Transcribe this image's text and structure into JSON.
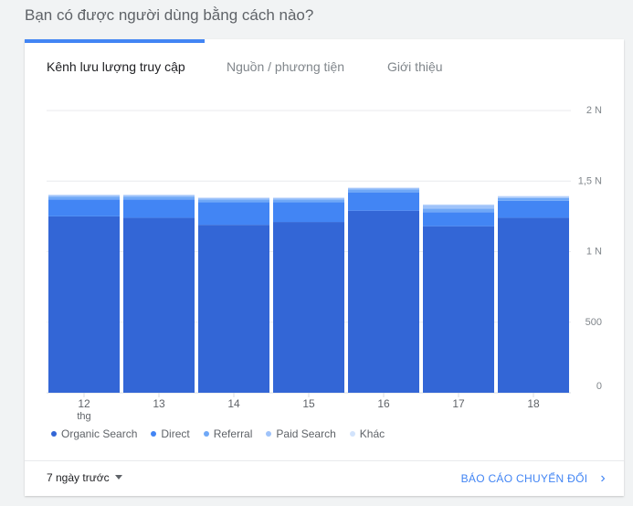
{
  "question": "Bạn có được người dùng bằng cách nào?",
  "tabs": [
    {
      "label": "Kênh lưu lượng truy cập",
      "active": true
    },
    {
      "label": "Nguồn / phương tiện",
      "active": false
    },
    {
      "label": "Giới thiệu",
      "active": false
    }
  ],
  "footer": {
    "range_label": "7 ngày trước",
    "report_label": "BÁO CÁO CHUYỂN ĐỔI"
  },
  "chart_data": {
    "type": "bar",
    "stacked": true,
    "categories": [
      "12",
      "13",
      "14",
      "15",
      "16",
      "17",
      "18"
    ],
    "category_sublabels": [
      "thg",
      "",
      "",
      "",
      "",
      "",
      ""
    ],
    "series": [
      {
        "name": "Organic Search",
        "color": "#3366d6",
        "values": [
          1250,
          1240,
          1190,
          1210,
          1290,
          1180,
          1240
        ]
      },
      {
        "name": "Direct",
        "color": "#4285f4",
        "values": [
          120,
          130,
          160,
          140,
          130,
          100,
          120
        ]
      },
      {
        "name": "Referral",
        "color": "#6fa8f7",
        "values": [
          20,
          20,
          20,
          20,
          20,
          25,
          20
        ]
      },
      {
        "name": "Paid Search",
        "color": "#9fc3fa",
        "values": [
          10,
          10,
          10,
          10,
          10,
          25,
          10
        ]
      },
      {
        "name": "Khác",
        "color": "#d2e3fc",
        "values": [
          5,
          5,
          5,
          5,
          5,
          5,
          5
        ]
      }
    ],
    "y_ticks": [
      {
        "value": 0,
        "label": "0"
      },
      {
        "value": 500,
        "label": "500"
      },
      {
        "value": 1000,
        "label": "1 N"
      },
      {
        "value": 1500,
        "label": "1,5 N"
      },
      {
        "value": 2000,
        "label": "2 N"
      }
    ],
    "ylim": [
      0,
      2000
    ],
    "grid": true,
    "legend": "bottom-left"
  }
}
